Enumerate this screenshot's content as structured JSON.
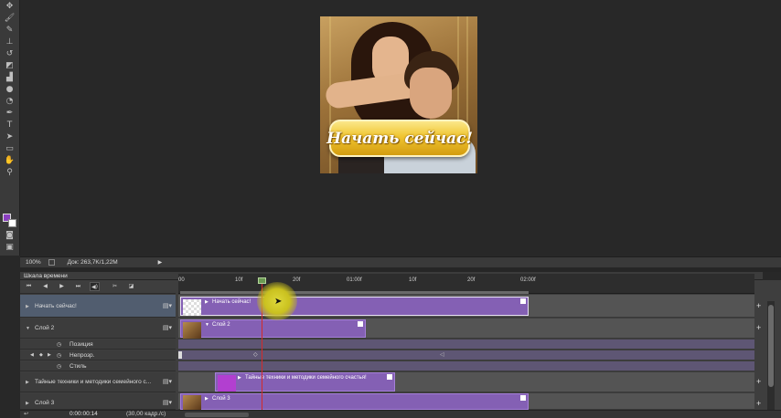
{
  "canvas": {
    "cta_text": "Начать сейчас!"
  },
  "status": {
    "zoom": "100%",
    "doc_info": "Док: 263,7K/1,22M"
  },
  "timeline": {
    "panel_title": "Шкала времени",
    "ticks": [
      "00",
      "10f",
      "20f",
      "01:00f",
      "10f",
      "20f",
      "02:00f"
    ],
    "layers": [
      {
        "name": "Начать сейчас!",
        "clip_label": "Начать сейчас!"
      },
      {
        "name": "Слой 2",
        "clip_label": "Слой 2"
      },
      {
        "name": "Позиция"
      },
      {
        "name": "Непрозр."
      },
      {
        "name": "Стиль"
      },
      {
        "name": "Тайные техники  и методики  семейного с...",
        "clip_label": "Тайные техники  и методики  семейного счастья!"
      },
      {
        "name": "Слой 3",
        "clip_label": "Слой 3"
      }
    ],
    "timecode": "0:00:00:14",
    "fps": "(30,00 кадр./с)"
  },
  "colors": {
    "clip": "#8460b4",
    "playhead": "#d42a2a",
    "foreground_swatch": "#8a3fc0"
  },
  "icons": {
    "tools": [
      "brush-icon",
      "pencil-icon",
      "stamp-icon",
      "history-brush-icon",
      "eraser-icon",
      "bucket-icon",
      "blur-icon",
      "dodge-icon",
      "pen-icon",
      "type-icon",
      "path-select-icon",
      "shape-icon",
      "hand-icon",
      "zoom-icon"
    ]
  }
}
